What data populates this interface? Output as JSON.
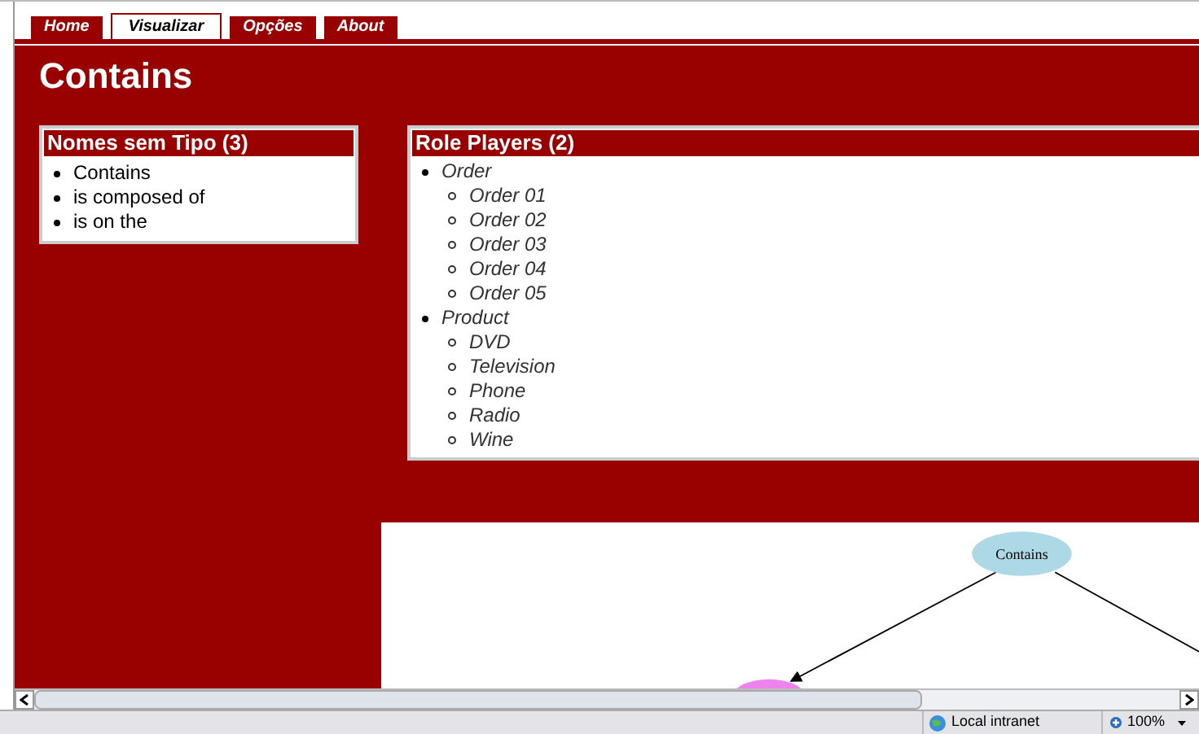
{
  "tabs": [
    {
      "label": "Home",
      "selected": false
    },
    {
      "label": "Visualizar",
      "selected": true
    },
    {
      "label": "Opções",
      "selected": false
    },
    {
      "label": "About",
      "selected": false
    }
  ],
  "title": "Contains",
  "untyped_names": {
    "title": "Nomes sem Tipo (3)",
    "items": [
      "Contains",
      "is composed of",
      "is on the"
    ]
  },
  "role_players": {
    "title": "Role Players (2)",
    "items": [
      {
        "label": "Order",
        "children": [
          {
            "label": "Order 01"
          },
          {
            "label": "Order 02"
          },
          {
            "label": "Order 03"
          },
          {
            "label": "Order 04"
          },
          {
            "label": "Order 05"
          }
        ]
      },
      {
        "label": "Product",
        "children": [
          {
            "label": "DVD"
          },
          {
            "label": "Television"
          },
          {
            "label": "Phone"
          },
          {
            "label": "Radio"
          },
          {
            "label": "Wine"
          }
        ]
      }
    ]
  },
  "graph": {
    "root": "Contains"
  },
  "status_bar": {
    "zone": "Local intranet",
    "zoom": "100%"
  }
}
